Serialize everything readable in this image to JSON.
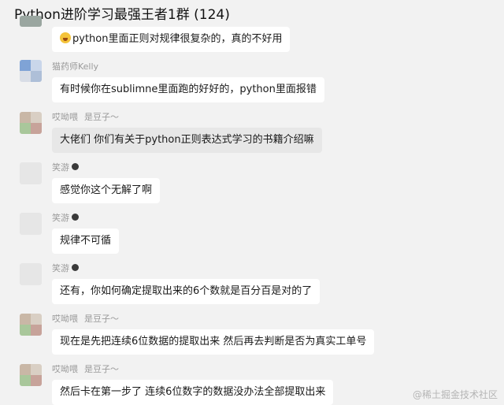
{
  "header": {
    "title": "Python进阶学习最强王者1群 (124)"
  },
  "messages": [
    {
      "sender": "",
      "tag": "",
      "text": "python里面正则对规律很复杂的，真的不好用",
      "emoji": true
    },
    {
      "sender": "猫药师Kelly",
      "tag": "",
      "text": "有时候你在sublimne里面跑的好好的，python里面报错"
    },
    {
      "sender": "哎呦喂",
      "tag": "是豆子～",
      "text": "大佬们  你们有关于python正则表达式学习的书籍介绍嘛"
    },
    {
      "sender": "笑游",
      "tag": "",
      "text": "感觉你这个无解了啊"
    },
    {
      "sender": "笑游",
      "tag": "",
      "text": "规律不可循"
    },
    {
      "sender": "笑游",
      "tag": "",
      "text": "还有，你如何确定提取出来的6个数就是百分百是对的了"
    },
    {
      "sender": "哎呦喂",
      "tag": "是豆子～",
      "text": "现在是先把连续6位数据的提取出来  然后再去判断是否为真实工单号"
    },
    {
      "sender": "哎呦喂",
      "tag": "是豆子～",
      "text": "然后卡在第一步了  连续6位数字的数据没办法全部提取出来"
    }
  ],
  "watermark": "@稀土掘金技术社区",
  "colors": {
    "background": "#f2f2f2",
    "bubble": "#ffffff",
    "bubble_highlight": "#e7e7e7",
    "meta_text": "#9a9a9a"
  }
}
